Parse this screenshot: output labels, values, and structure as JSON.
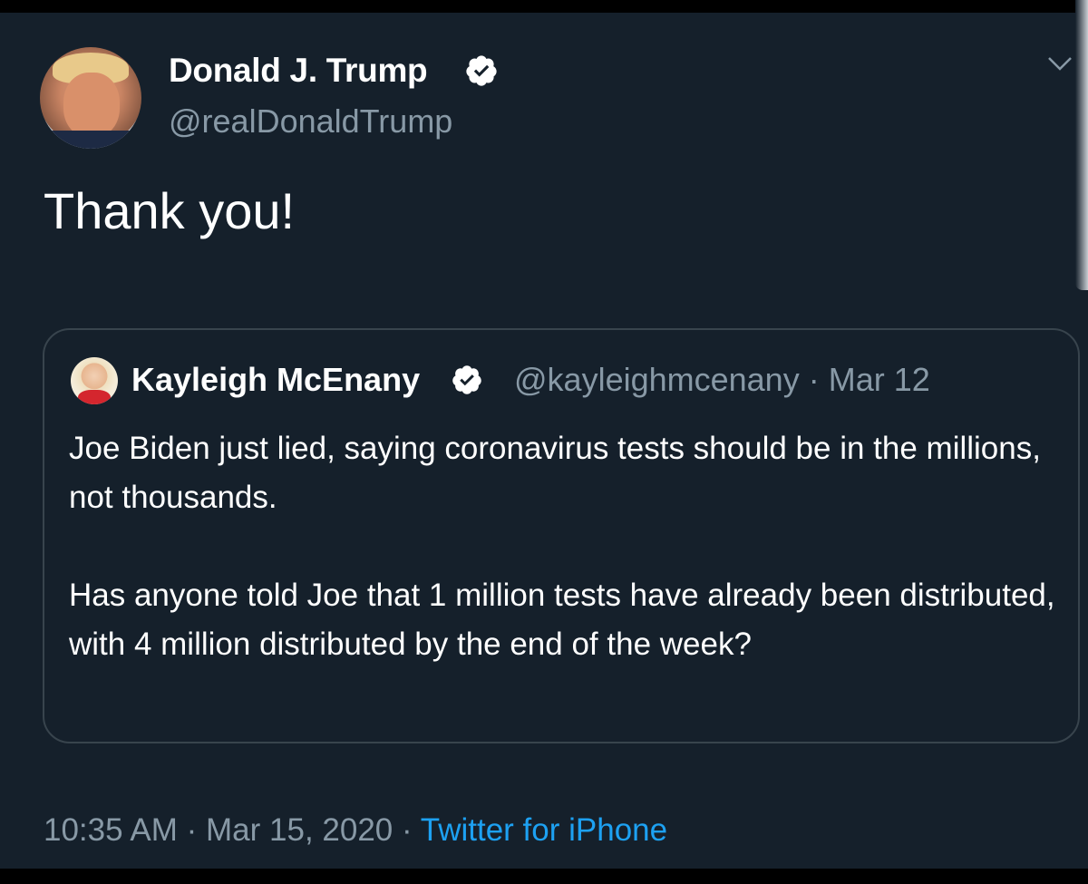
{
  "tweet": {
    "author_name": "Donald J. Trump",
    "author_handle": "@realDonaldTrump",
    "text": "Thank you!",
    "time": "10:35 AM",
    "date": "Mar 15, 2020",
    "separator": "·",
    "source": "Twitter for iPhone"
  },
  "quoted": {
    "author_name": "Kayleigh McEnany",
    "author_handle": "@kayleighmcenany",
    "separator": "·",
    "date": "Mar 12",
    "paragraph_1": "Joe Biden just lied, saying coronavirus tests should be in the millions, not thousands.",
    "paragraph_2": "Has anyone told Joe that 1 million tests have already been distributed, with 4 million distributed by the end of the week?"
  },
  "colors": {
    "background": "#15202b",
    "text": "#ffffff",
    "secondary_text": "#8899a6",
    "link": "#1da1f2",
    "border": "#38444d",
    "verified_badge": "#ffffff"
  },
  "icons": [
    "verified-badge-icon",
    "chevron-down-icon"
  ]
}
